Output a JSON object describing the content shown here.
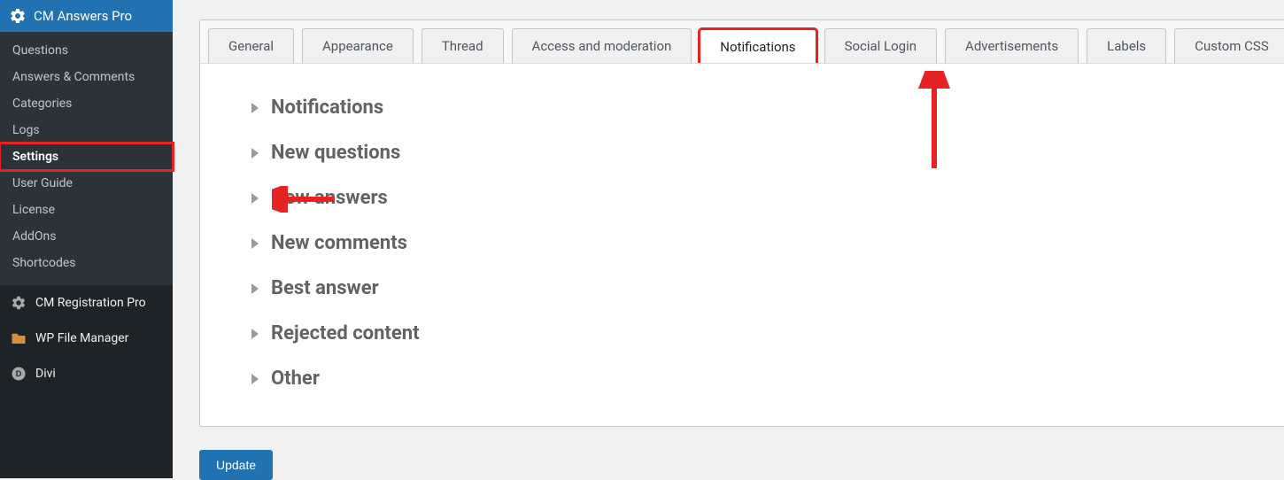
{
  "annotations": {
    "highlight_color": "#e62323",
    "arrow_color": "#e62323"
  },
  "sidebar": {
    "active_menu": {
      "label": "CM Answers Pro"
    },
    "submenu": [
      {
        "label": "Questions"
      },
      {
        "label": "Answers & Comments"
      },
      {
        "label": "Categories"
      },
      {
        "label": "Logs"
      },
      {
        "label": "Settings",
        "active": true,
        "highlighted": true
      },
      {
        "label": "User Guide"
      },
      {
        "label": "License"
      },
      {
        "label": "AddOns"
      },
      {
        "label": "Shortcodes"
      }
    ],
    "other_menus": [
      {
        "icon": "gear",
        "label": "CM Registration Pro"
      },
      {
        "icon": "folder",
        "label": "WP File Manager"
      },
      {
        "icon": "divi",
        "label": "Divi"
      }
    ]
  },
  "tabs": [
    {
      "label": "General"
    },
    {
      "label": "Appearance"
    },
    {
      "label": "Thread"
    },
    {
      "label": "Access and moderation"
    },
    {
      "label": "Notifications",
      "active": true,
      "highlighted": true
    },
    {
      "label": "Social Login"
    },
    {
      "label": "Advertisements"
    },
    {
      "label": "Labels"
    },
    {
      "label": "Custom CSS"
    }
  ],
  "sections": [
    {
      "label": "Notifications"
    },
    {
      "label": "New questions"
    },
    {
      "label": "New answers"
    },
    {
      "label": "New comments"
    },
    {
      "label": "Best answer"
    },
    {
      "label": "Rejected content"
    },
    {
      "label": "Other"
    }
  ],
  "buttons": {
    "update": "Update"
  }
}
